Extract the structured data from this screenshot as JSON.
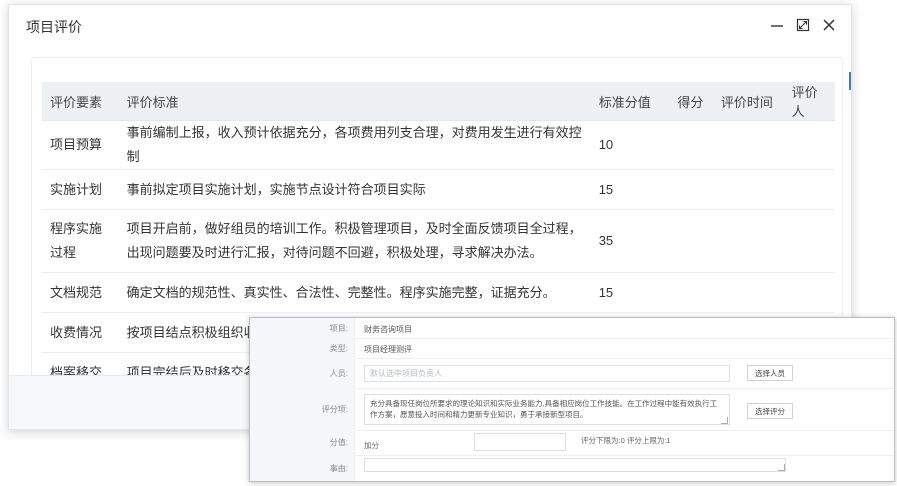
{
  "dialog": {
    "title": "项目评价",
    "table": {
      "headers": [
        "评价要素",
        "评价标准",
        "标准分值",
        "得分",
        "评价时间",
        "评价人"
      ],
      "rows": [
        {
          "element": "项目预算",
          "standard": "事前编制上报，收入预计依据充分，各项费用列支合理，对费用发生进行有效控制",
          "score": "10"
        },
        {
          "element": "实施计划",
          "standard": "事前拟定项目实施计划，实施节点设计符合项目实际",
          "score": "15"
        },
        {
          "element": "程序实施过程",
          "standard": "项目开启前，做好组员的培训工作。积极管理项目，及时全面反馈项目全过程，出现问题要及时进行汇报，对待问题不回避，积极处理，寻求解决办法。",
          "score": "35"
        },
        {
          "element": "文档规范",
          "standard": "确定文档的规范性、真实性、合法性、完整性。程序实施完整，证据充分。",
          "score": "15"
        },
        {
          "element": "收费情况",
          "standard": "按项目结点积极组织收",
          "score": ""
        },
        {
          "element": "档案移交",
          "standard": "项目完结后及时移交各",
          "score": ""
        }
      ]
    }
  },
  "form": {
    "project_label": "项目:",
    "project_value": "财务咨询项目",
    "type_label": "类型:",
    "type_value": "项目经理测评",
    "person_label": "人员:",
    "person_placeholder": "默认选中项目负责人",
    "select_person_button": "选择人员",
    "criteria_label": "评分项:",
    "criteria_text": "充分具备现任岗位所要求的理论知识和实际业务能力,具备相应岗位工作技能。在工作过程中能有效执行工作方案，愿意投入时间和精力更新专业知识，勇于承接新型项目。",
    "select_criteria_button": "选择评分",
    "score_label": "分值:",
    "score_mode": "加分",
    "score_range": "评分下限为:0 评分上限为:1",
    "reason_label": "事由:"
  },
  "colors": {
    "header_bg": "#eef1f4",
    "accent": "#3a7bd5"
  }
}
